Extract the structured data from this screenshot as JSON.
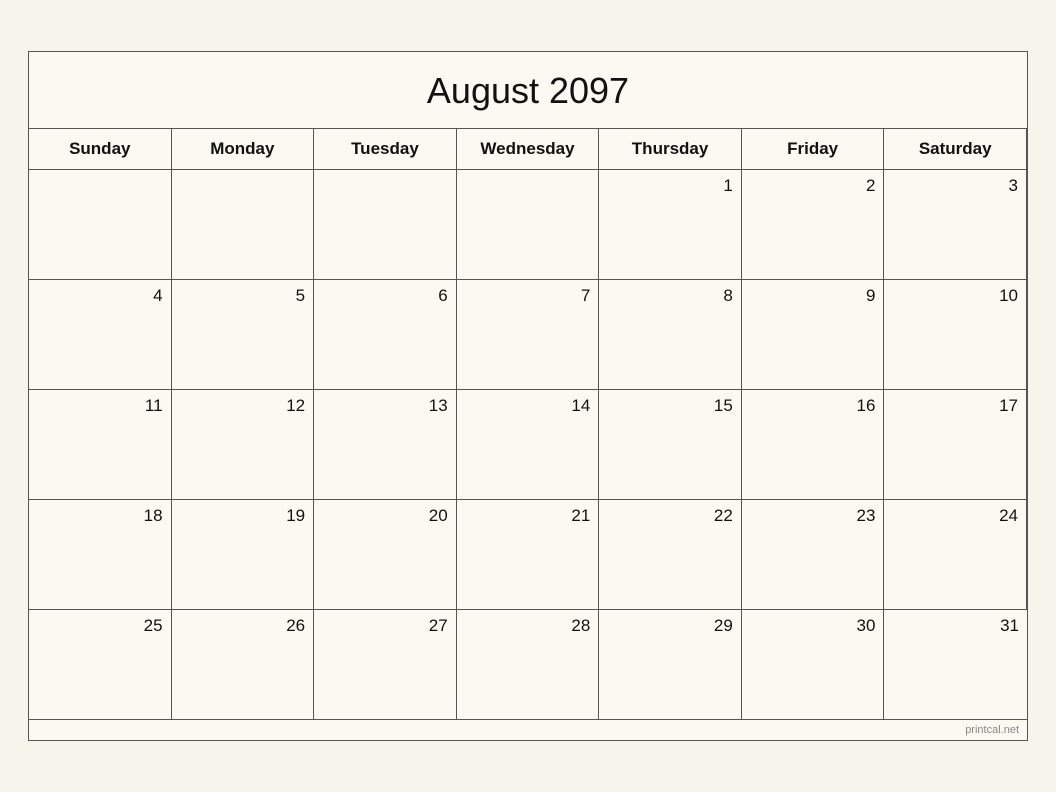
{
  "calendar": {
    "title": "August 2097",
    "watermark": "printcal.net",
    "headers": [
      "Sunday",
      "Monday",
      "Tuesday",
      "Wednesday",
      "Thursday",
      "Friday",
      "Saturday"
    ],
    "weeks": [
      [
        {
          "day": "",
          "empty": true
        },
        {
          "day": "",
          "empty": true
        },
        {
          "day": "",
          "empty": true
        },
        {
          "day": "",
          "empty": true
        },
        {
          "day": "1",
          "empty": false
        },
        {
          "day": "2",
          "empty": false
        },
        {
          "day": "3",
          "empty": false
        }
      ],
      [
        {
          "day": "4",
          "empty": false
        },
        {
          "day": "5",
          "empty": false
        },
        {
          "day": "6",
          "empty": false
        },
        {
          "day": "7",
          "empty": false
        },
        {
          "day": "8",
          "empty": false
        },
        {
          "day": "9",
          "empty": false
        },
        {
          "day": "10",
          "empty": false
        }
      ],
      [
        {
          "day": "11",
          "empty": false
        },
        {
          "day": "12",
          "empty": false
        },
        {
          "day": "13",
          "empty": false
        },
        {
          "day": "14",
          "empty": false
        },
        {
          "day": "15",
          "empty": false
        },
        {
          "day": "16",
          "empty": false
        },
        {
          "day": "17",
          "empty": false
        }
      ],
      [
        {
          "day": "18",
          "empty": false
        },
        {
          "day": "19",
          "empty": false
        },
        {
          "day": "20",
          "empty": false
        },
        {
          "day": "21",
          "empty": false
        },
        {
          "day": "22",
          "empty": false
        },
        {
          "day": "23",
          "empty": false
        },
        {
          "day": "24",
          "empty": false
        }
      ],
      [
        {
          "day": "25",
          "empty": false
        },
        {
          "day": "26",
          "empty": false
        },
        {
          "day": "27",
          "empty": false
        },
        {
          "day": "28",
          "empty": false
        },
        {
          "day": "29",
          "empty": false
        },
        {
          "day": "30",
          "empty": false
        },
        {
          "day": "31",
          "empty": false
        }
      ]
    ]
  }
}
